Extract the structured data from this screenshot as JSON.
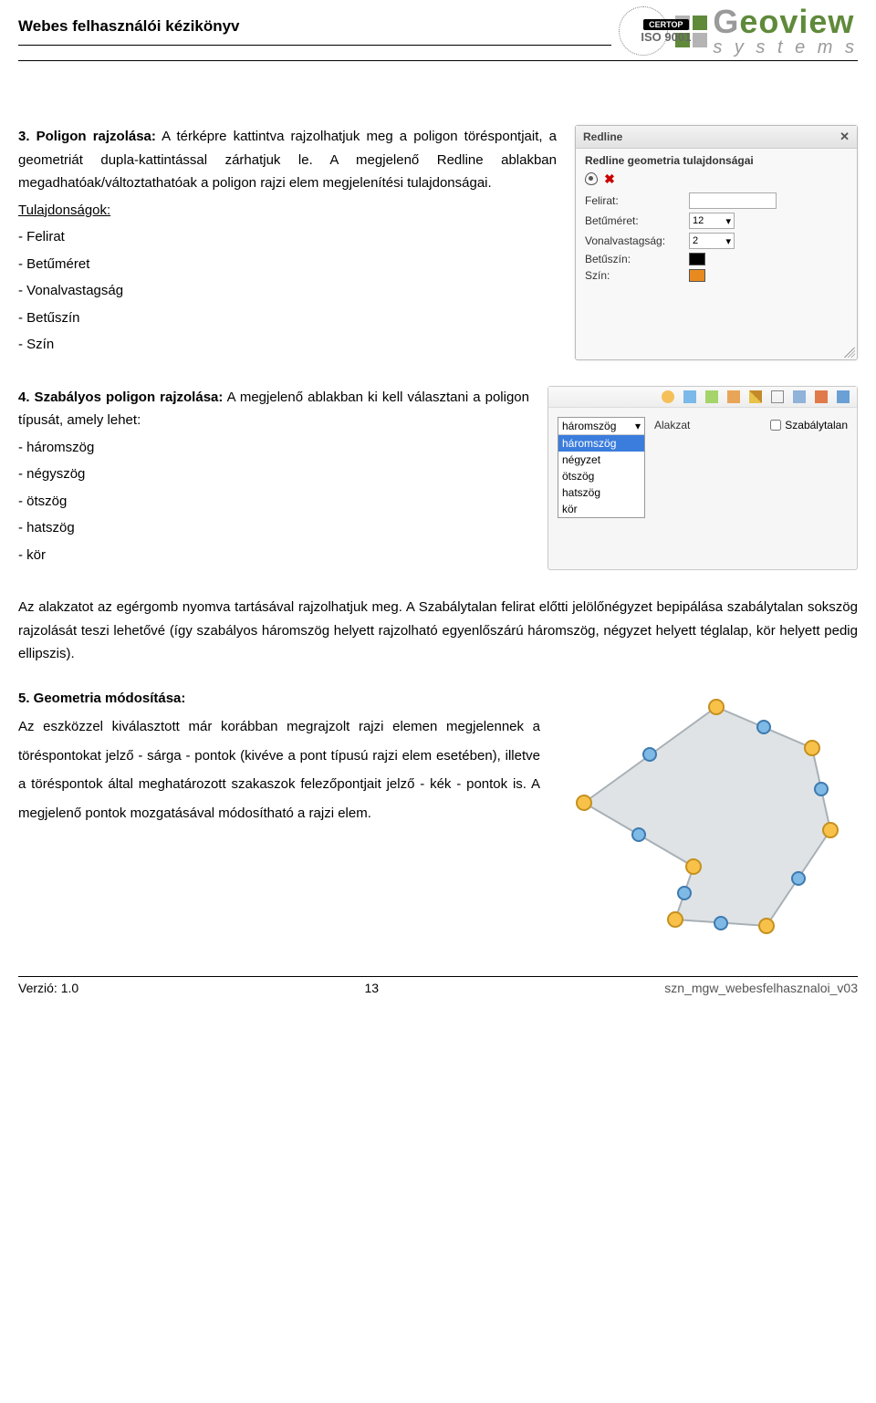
{
  "header": {
    "left_title": "Webes felhasználói kézikönyv",
    "iso_label": "ISO 9001",
    "certop_label": "CERTOP",
    "brand_main": "Geoview",
    "brand_sub": "s y s t e m s"
  },
  "section3": {
    "lead": "3. Poligon rajzolása:",
    "body1": " A térképre kattintva rajzolhatjuk meg a poligon töréspontjait, a geometriát dupla-kattintással zárhatjuk le. A megjelenő Redline ablakban megadhatóak/változtathatóak a poligon rajzi elem megjelenítési tulajdonságai.",
    "props_head": "Tulajdonságok:",
    "props": [
      "- Felirat",
      "- Betűméret",
      "- Vonalvastagság",
      "- Betűszín",
      "- Szín"
    ]
  },
  "redline_panel": {
    "title": "Redline",
    "subhead": "Redline geometria tulajdonságai",
    "rows": {
      "felirat_label": "Felirat:",
      "felirat_value": "",
      "betumeret_label": "Betűméret:",
      "betumeret_value": "12",
      "vonalvastag_label": "Vonalvastagság:",
      "vonalvastag_value": "2",
      "betuszin_label": "Betűszín:",
      "szin_label": "Szín:"
    }
  },
  "section4": {
    "lead": "4. Szabályos poligon rajzolása:",
    "body1": "A megjelenő ablakban ki kell választani a poligon típusát, amely lehet:",
    "types": [
      "- háromszög",
      "- négyszög",
      "- ötszög",
      "- hatszög",
      "- kör"
    ]
  },
  "poly_panel": {
    "select_head": "háromszög",
    "options": [
      "háromszög",
      "négyzet",
      "ötszög",
      "hatszög",
      "kör"
    ],
    "alakzat_label": "Alakzat",
    "irregular_label": "Szabálytalan"
  },
  "after4_para": "Az alakzatot az egérgomb nyomva tartásával rajzolhatjuk meg. A Szabálytalan felirat előtti jelölőnégyzet bepipálása szabálytalan sokszög rajzolását teszi lehetővé (így szabályos háromszög helyett rajzolható egyenlőszárú háromszög, négyzet helyett téglalap, kör helyett pedig ellipszis).",
  "section5": {
    "lead": "5. Geometria módosítása:",
    "body": "Az eszközzel kiválasztott már korábban megrajzolt rajzi elemen megjelennek a töréspontokat jelző - sárga - pontok (kivéve a pont típusú rajzi elem esetében), illetve a töréspontok által meghatározott szakaszok felezőpontjait jelző - kék - pontok is. A megjelenő pontok mozgatásával módosítható a rajzi elem."
  },
  "footer": {
    "version": "Verzió: 1.0",
    "page": "13",
    "right_cut": "szn_mgw_webesfelhasznaloi_v03"
  }
}
